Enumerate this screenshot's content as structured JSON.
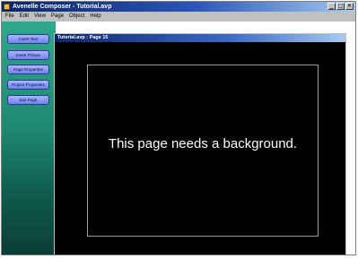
{
  "app": {
    "title": "Avenelle Composer - Tutorial.avp",
    "controls": {
      "minimize": "_",
      "maximize": "□",
      "close": "✕"
    }
  },
  "menu": [
    "File",
    "Edit",
    "View",
    "Page",
    "Object",
    "Help"
  ],
  "sidebar": {
    "buttons": [
      "Insert Text",
      "Insert Picture",
      "Page Properties",
      "Project Properties",
      "Exit Page"
    ]
  },
  "document": {
    "title": "Tutorial.avp : Page 15",
    "message": "This page needs a background."
  },
  "colors": {
    "titlebar": "#0a246a",
    "sidebar_top": "#2fa88d",
    "sidebar_bottom": "#0a3e36",
    "button_fill": "#7f92ee",
    "canvas": "#000000"
  }
}
